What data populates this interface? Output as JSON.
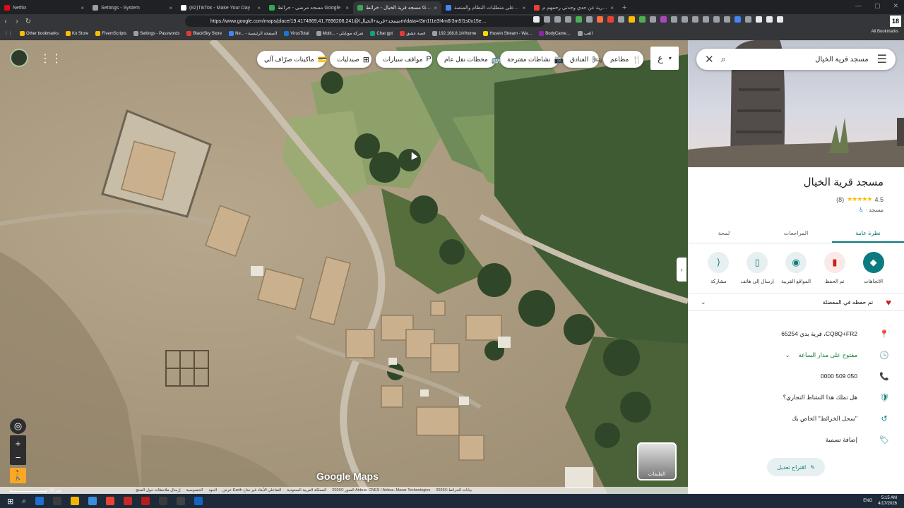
{
  "browser": {
    "tabs": [
      {
        "title": "Netflix",
        "color": "#e50914",
        "active": false
      },
      {
        "title": "Settings - System",
        "color": "#9aa0a6",
        "active": false
      },
      {
        "title": "(82)TikTok - Make Your Day",
        "color": "#ffffff",
        "active": false
      },
      {
        "title": "مسجد مرضى - خرائط Google",
        "color": "#34a853",
        "active": false
      },
      {
        "title": "مسجد قرية الخيال - خرائط Google",
        "color": "#34a853",
        "active": true
      },
      {
        "title": "الاطلاع على متطلبات النظام والمنصة…",
        "color": "#4285f4",
        "active": false
      },
      {
        "title": "صدقة جارية عن جدي وجدتي رحمهم م…",
        "color": "#ea4335",
        "active": false
      }
    ],
    "new_tab": "+",
    "window_controls": [
      "—",
      "▢",
      "✕"
    ],
    "url": "https://www.google.com/maps/place/مسجد+قرية+الخيال/@19.4174869,41.7896208,241m/data=!3m1!1e3!4m6!3m5!1s0x15e…",
    "profile_letter": "18",
    "bookmarks": [
      {
        "label": "Other bookmarks",
        "color": "#fbbc04"
      },
      {
        "label": "Ko Store",
        "color": "#fbbc04"
      },
      {
        "label": "FivemScripts",
        "color": "#fbbc04"
      },
      {
        "label": "Settings - Passwords",
        "color": "#9aa0a6"
      },
      {
        "label": "BlackSky Store",
        "color": "#e53935"
      },
      {
        "label": "Ne... - الصفحة الرئيسية",
        "color": "#4285f4"
      },
      {
        "label": "VirusTotal",
        "color": "#1976d2"
      },
      {
        "label": "Mobi... - شركة موبايلي",
        "color": "#9aa0a6"
      },
      {
        "label": "Chat gpt",
        "color": "#10a37f"
      },
      {
        "label": "قصة عشق",
        "color": "#e53935"
      },
      {
        "label": "192.168.8.1/#/home",
        "color": "#9aa0a6"
      },
      {
        "label": "Husein Stream - Wa…",
        "color": "#ffd600"
      },
      {
        "label": "BodyCame…",
        "color": "#8e24aa"
      },
      {
        "label": "العب",
        "color": "#9aa0a6"
      }
    ],
    "all_bookmarks": "All Bookmarks"
  },
  "map": {
    "chips": [
      {
        "label": "مطاعم",
        "icon": "🍴"
      },
      {
        "label": "الفنادق",
        "icon": "🛏"
      },
      {
        "label": "نشاطات مقترحة",
        "icon": "📷"
      },
      {
        "label": "محطات نقل عام",
        "icon": "🚌"
      },
      {
        "label": "مواقف سيارات",
        "icon": "P"
      },
      {
        "label": "صيدليات",
        "icon": "⊞"
      },
      {
        "label": "ماكينات صرّاف آلي",
        "icon": "💳"
      }
    ],
    "language_chip": "ع",
    "language_chevron": "▾",
    "apps_icon": "⋮⋮",
    "zoom_in": "+",
    "zoom_out": "−",
    "locate": "◎",
    "pegman": "🚶",
    "layers_label": "الطبقات",
    "logo": "Google Maps",
    "scale": "20 متر",
    "attribution": [
      "بيانات الخرائط ©2026",
      "الصور ©2026 Airbus، CNES / Airbus، Maxar Technologies",
      "المملكة العربية السعودية",
      "عرض Earth التفاعلي الأبعاد غير متاح",
      "البنود",
      "الخصوصية",
      "إرسال ملاحظات حول المنتج"
    ],
    "collapse_icon": "›"
  },
  "panel": {
    "search_query": "مسجد قرية الخيال",
    "menu_icon": "☰",
    "search_icon": "⌕",
    "close_icon": "✕",
    "place_name": "مسجد قرية الخيال",
    "rating": "4.5",
    "stars": "★★★★★",
    "review_count": "(8)",
    "category": "مسجد ·",
    "tabs": [
      "نظرة عامة",
      "المراجعات",
      "لمحة"
    ],
    "actions": [
      {
        "label": "الاتجاهات",
        "icon": "◆"
      },
      {
        "label": "تم الحفظ",
        "icon": "▮"
      },
      {
        "label": "المواقع القريبة",
        "icon": "◉"
      },
      {
        "label": "إرسال إلى هاتف",
        "icon": "▯"
      },
      {
        "label": "مشاركة",
        "icon": "⟨"
      }
    ],
    "saved_text": "تم حفظه في المفضلة",
    "saved_heart": "♥",
    "saved_chevron": "⌄",
    "info": [
      {
        "icon": "📍",
        "text": "CQ8Q+FR2، قرية بدي 65254"
      },
      {
        "icon": "🕒",
        "text": "مفتوح على مدار الساعة",
        "chevron": "⌄"
      },
      {
        "icon": "📞",
        "text": "050 509 0000"
      },
      {
        "icon": "🛡",
        "text": "هل تملك هذا النشاط التجاري؟"
      },
      {
        "icon": "↺",
        "text": "\"سجل الخرائط\" الخاص بك"
      },
      {
        "icon": "🏷",
        "text": "إضافة تسمية"
      }
    ],
    "suggest_edit": "اقتراح تعديل",
    "suggest_icon": "✎"
  },
  "taskbar": {
    "apps": [
      "#1f6fd1",
      "#3c3c3c",
      "#f2b600",
      "#3b8ed8",
      "#ea4335",
      "#c62828",
      "#b71c1c",
      "#3b3b3b",
      "#424242",
      "#1565c0"
    ],
    "lang": "ENG",
    "time": "5:15 AM",
    "date": "4/17/2026"
  }
}
